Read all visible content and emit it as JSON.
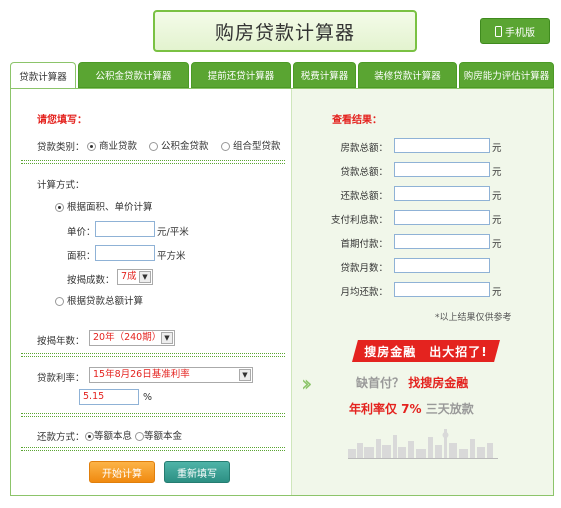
{
  "header": {
    "title": "购房贷款计算器",
    "mobile_label": "手机版"
  },
  "tabs": [
    "贷款计算器",
    "公积金贷款计算器",
    "提前还贷计算器",
    "税费计算器",
    "装修贷款计算器",
    "购房能力评估计算器"
  ],
  "left": {
    "fill_title": "请您填写：",
    "loan_type_label": "贷款类别：",
    "loan_types": [
      "商业贷款",
      "公积金贷款",
      "组合型贷款"
    ],
    "calc_method_label": "计算方式：",
    "method_area": "根据面积、单价计算",
    "unit_price_label": "单价：",
    "unit_price_unit": "元/平米",
    "area_label": "面积：",
    "area_unit": "平方米",
    "ratio_label": "按揭成数：",
    "ratio_value": "7成",
    "method_total": "根据贷款总额计算",
    "years_label": "按揭年数：",
    "years_value": "20年（240期）",
    "rate_label": "贷款利率：",
    "rate_value": "15年8月26日基准利率",
    "rate_input": "5.15",
    "rate_unit": "%",
    "repay_label": "还款方式：",
    "repay_options": [
      "等额本息",
      "等额本金"
    ],
    "start_button": "开始计算",
    "reset_button": "重新填写"
  },
  "right": {
    "result_title": "查看结果：",
    "results": [
      {
        "label": "房款总额：",
        "unit": "元"
      },
      {
        "label": "贷款总额：",
        "unit": "元"
      },
      {
        "label": "还款总额：",
        "unit": "元"
      },
      {
        "label": "支付利息款：",
        "unit": "元"
      },
      {
        "label": "首期付款：",
        "unit": "元"
      },
      {
        "label": "贷款月数：",
        "unit": ""
      },
      {
        "label": "月均还款：",
        "unit": "元"
      }
    ],
    "note": "*以上结果仅供参考",
    "ad": {
      "banner": "搜房金融　出大招了!",
      "line1_a": "缺首付？",
      "line1_b": "找搜房金融",
      "line2_a": "年利率仅 7%",
      "line2_b": "三天放款"
    }
  },
  "colors": {
    "accent_green": "#5aa532",
    "highlight_red": "#e4231f",
    "orange_button": "#f08a10",
    "teal_button": "#2c8f83"
  }
}
